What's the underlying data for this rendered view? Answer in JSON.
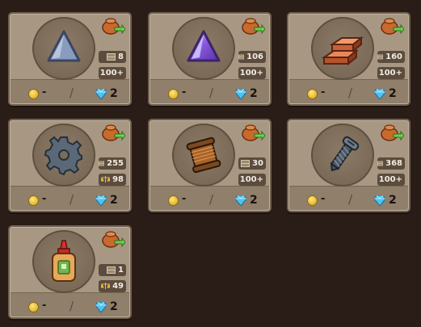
{
  "items": [
    {
      "name": "triangle-stone",
      "stock": "8",
      "limit": "100+",
      "coin": "-",
      "gem": "2"
    },
    {
      "name": "crystal",
      "stock": "106",
      "limit": "100+",
      "coin": "-",
      "gem": "2"
    },
    {
      "name": "copper-ingot",
      "stock": "160",
      "limit": "100+",
      "coin": "-",
      "gem": "2"
    },
    {
      "name": "gear",
      "stock": "255",
      "limit": "98",
      "coin": "-",
      "gem": "2"
    },
    {
      "name": "thread-spool",
      "stock": "30",
      "limit": "100+",
      "coin": "-",
      "gem": "2"
    },
    {
      "name": "screw",
      "stock": "368",
      "limit": "100+",
      "coin": "-",
      "gem": "2"
    },
    {
      "name": "glue-bottle",
      "stock": "1",
      "limit": "49",
      "coin": "-",
      "gem": "2"
    }
  ],
  "separator": "/",
  "colors": {
    "card": "#a89883",
    "badge": "#5b4c3d",
    "background": "#2a1d17"
  }
}
